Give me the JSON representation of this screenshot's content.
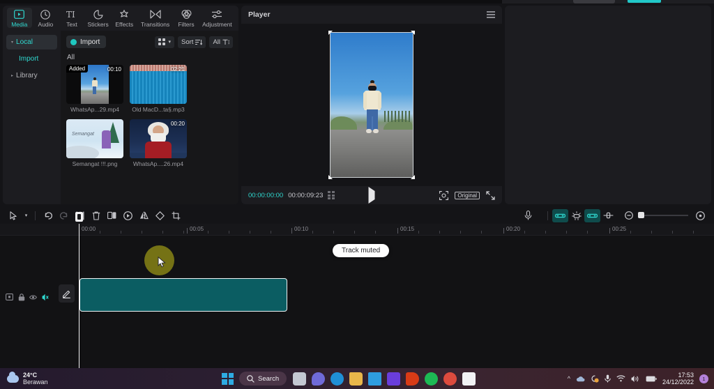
{
  "nav": {
    "tabs": [
      {
        "label": "Media",
        "icon": "media-icon",
        "active": true
      },
      {
        "label": "Audio",
        "icon": "audio-icon",
        "active": false
      },
      {
        "label": "Text",
        "icon": "text-icon",
        "active": false
      },
      {
        "label": "Stickers",
        "icon": "stickers-icon",
        "active": false
      },
      {
        "label": "Effects",
        "icon": "effects-icon",
        "active": false
      },
      {
        "label": "Transitions",
        "icon": "transitions-icon",
        "active": false
      },
      {
        "label": "Filters",
        "icon": "filters-icon",
        "active": false
      },
      {
        "label": "Adjustment",
        "icon": "adjustment-icon",
        "active": false
      }
    ]
  },
  "library": {
    "items": [
      {
        "label": "Local",
        "selected": true,
        "sub": false
      },
      {
        "label": "Import",
        "selected": false,
        "sub": true
      },
      {
        "label": "Library",
        "selected": false,
        "sub": false
      }
    ]
  },
  "media": {
    "import_label": "Import",
    "view_label": "",
    "sort_label": "Sort",
    "filter_label": "All",
    "section_label": "All",
    "items": [
      {
        "name": "WhatsAp...29.mp4",
        "duration": "00:10",
        "badge": "Added",
        "art": "road"
      },
      {
        "name": "Old MacD...ta§.mp3",
        "duration": "02:21",
        "badge": "",
        "art": "wave"
      },
      {
        "name": "Semangat !!!.png",
        "duration": "",
        "badge": "",
        "art": "snow"
      },
      {
        "name": "WhatsAp....26.mp4",
        "duration": "00:20",
        "badge": "",
        "art": "santa"
      }
    ]
  },
  "player": {
    "title": "Player",
    "current_time": "00:00:00:00",
    "total_time": "00:00:09:23",
    "quality_label": "Original"
  },
  "timeline": {
    "tools": [
      {
        "name": "select-tool",
        "state": "normal"
      },
      {
        "name": "select-dropdown",
        "state": "normal"
      },
      {
        "name": "undo-button",
        "state": "normal"
      },
      {
        "name": "redo-button",
        "state": "disabled"
      },
      {
        "name": "split-button",
        "state": "normal"
      },
      {
        "name": "delete-button",
        "state": "normal"
      },
      {
        "name": "duplicate-button",
        "state": "normal"
      },
      {
        "name": "speed-button",
        "state": "normal"
      },
      {
        "name": "mirror-button",
        "state": "normal"
      },
      {
        "name": "rotate-button",
        "state": "normal"
      },
      {
        "name": "crop-button",
        "state": "normal"
      }
    ],
    "right_tools": [
      {
        "name": "record-voiceover-button",
        "state": "normal"
      },
      {
        "name": "link-clips-button",
        "state": "on"
      },
      {
        "name": "auto-ducking-button",
        "state": "normal"
      },
      {
        "name": "snap-button",
        "state": "on"
      },
      {
        "name": "adjust-clip-button",
        "state": "normal"
      },
      {
        "name": "zoom-out-button",
        "state": "normal"
      },
      {
        "name": "fit-timeline-button",
        "state": "normal"
      }
    ],
    "ruler_labels": [
      "00:00",
      "00:05",
      "00:10",
      "00:15",
      "00:20",
      "00:25"
    ],
    "track": {
      "controls": [
        {
          "name": "track-type-icon",
          "state": "normal"
        },
        {
          "name": "lock-track-icon",
          "state": "normal"
        },
        {
          "name": "hide-track-icon",
          "state": "normal"
        },
        {
          "name": "mute-track-icon",
          "state": "on"
        }
      ],
      "edit_button": "edit-clip-button"
    },
    "toast": "Track muted"
  },
  "taskbar": {
    "weather_temp": "24°C",
    "weather_desc": "Berawan",
    "search_label": "Search",
    "apps": [
      {
        "name": "task-view-icon",
        "color": "#c4c8d2"
      },
      {
        "name": "teams-icon",
        "color": "#6f6ad8"
      },
      {
        "name": "edge-icon",
        "color": "#1f8fd6"
      },
      {
        "name": "file-explorer-icon",
        "color": "#e9b64a"
      },
      {
        "name": "mail-icon",
        "color": "#2e9ce0"
      },
      {
        "name": "purple-app-icon",
        "color": "#6a3ddb"
      },
      {
        "name": "office-icon",
        "color": "#d83b16"
      },
      {
        "name": "spotify-icon",
        "color": "#1db954"
      },
      {
        "name": "chrome-icon",
        "color": "#dd4b3e"
      },
      {
        "name": "capcut-icon",
        "color": "#f2f2f4"
      }
    ],
    "clock_time": "17:53",
    "clock_date": "24/12/2022",
    "notification_count": "1"
  },
  "colors": {
    "accent": "#2fd9d0",
    "clip": "#0b5d62",
    "toast_bg": "#fdfdfd",
    "click_indicator": "#7d7a15"
  }
}
